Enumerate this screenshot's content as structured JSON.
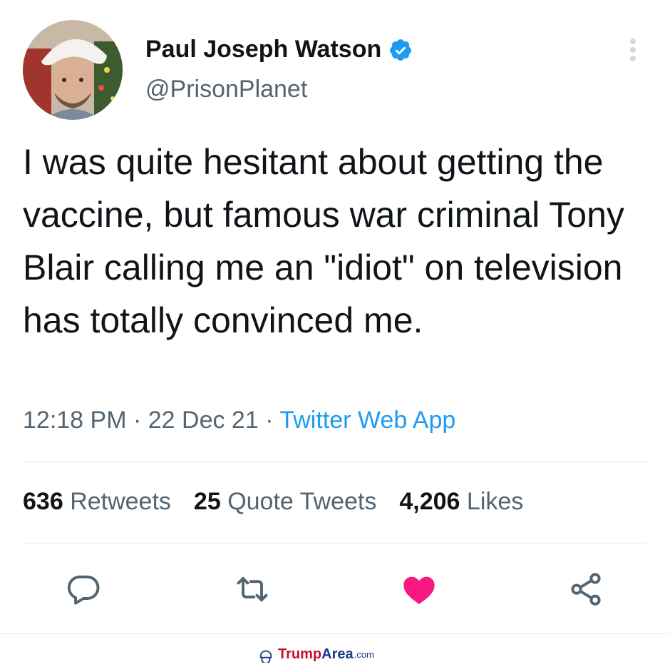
{
  "tweet": {
    "display_name": "Paul Joseph Watson",
    "handle": "@PrisonPlanet",
    "text": "I was quite hesitant about getting the vaccine, but famous war criminal Tony Blair calling me an \"idiot\" on television has totally convinced me.",
    "time": "12:18 PM",
    "separator": " · ",
    "date": "22 Dec 21",
    "source": "Twitter Web App",
    "verified": true
  },
  "stats": {
    "retweets_count": "636",
    "retweets_label": "Retweets",
    "quotes_count": "25",
    "quotes_label": "Quote Tweets",
    "likes_count": "4,206",
    "likes_label": "Likes"
  },
  "actions": [
    {
      "name": "reply-icon"
    },
    {
      "name": "retweet-icon"
    },
    {
      "name": "like-icon",
      "active": true
    },
    {
      "name": "share-icon"
    }
  ],
  "watermark": {
    "part1": "Trump",
    "part2": "Area",
    "part3": ".com"
  },
  "colors": {
    "verified_blue": "#1d9bf0",
    "like_pink": "#f91880",
    "text_primary": "#0f1419",
    "text_secondary": "#536471"
  }
}
